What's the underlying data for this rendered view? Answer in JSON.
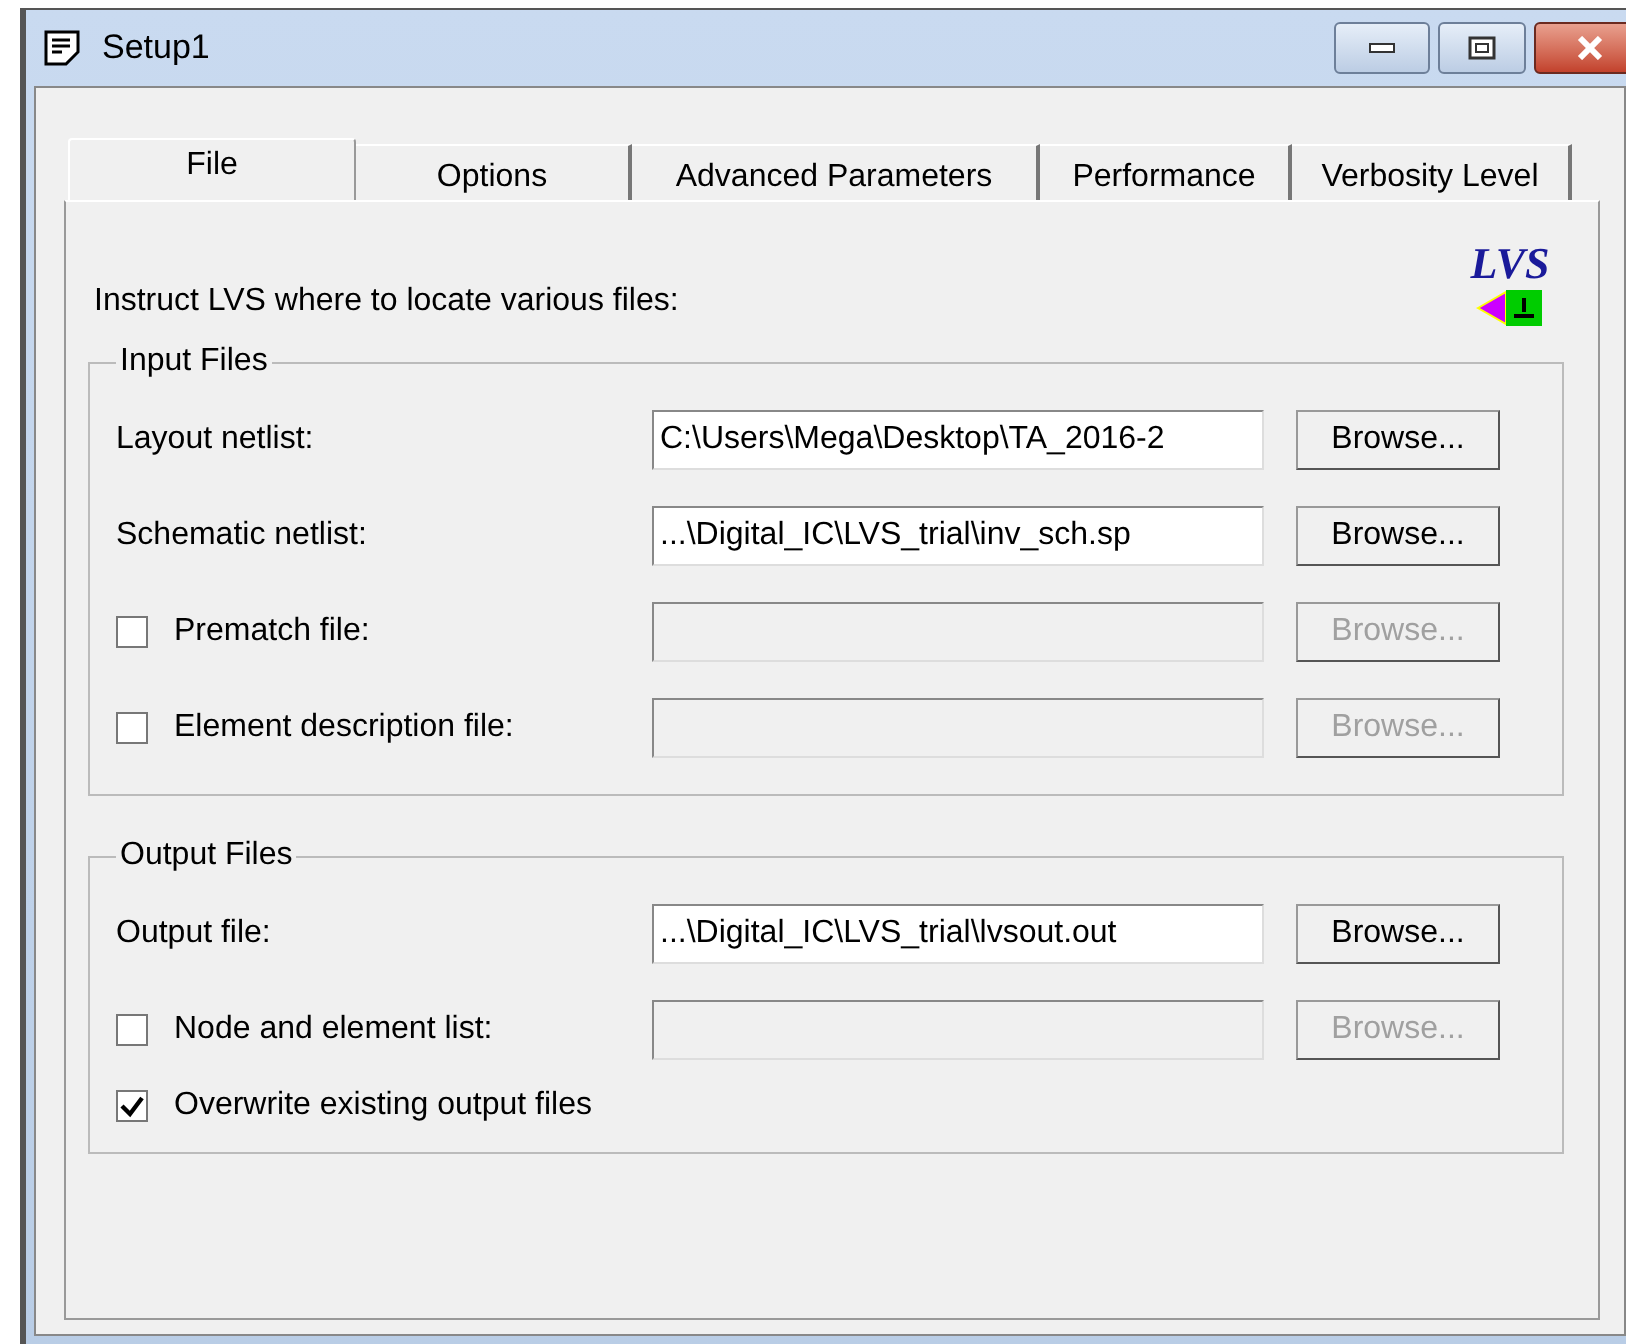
{
  "window": {
    "title": "Setup1"
  },
  "tabs": [
    {
      "label": "File",
      "selected": true
    },
    {
      "label": "Options",
      "selected": false
    },
    {
      "label": "Advanced Parameters",
      "selected": false
    },
    {
      "label": "Performance",
      "selected": false
    },
    {
      "label": "Verbosity Level",
      "selected": false
    }
  ],
  "instruction": "Instruct LVS where to locate various files:",
  "logo": {
    "text": "LVS"
  },
  "groups": [
    {
      "title": "Input Files",
      "rows": [
        {
          "kind": "file",
          "label": "Layout netlist:",
          "value": "C:\\Users\\Mega\\Desktop\\TA_2016-2",
          "button": "Browse...",
          "disabled": false
        },
        {
          "kind": "file",
          "label": "Schematic netlist:",
          "value": "...\\Digital_IC\\LVS_trial\\inv_sch.sp",
          "button": "Browse...",
          "disabled": false
        },
        {
          "kind": "checkfile",
          "label": "Prematch file:",
          "checked": false,
          "button": "Browse...",
          "disabled": true
        },
        {
          "kind": "checkfile",
          "label": "Element description file:",
          "checked": false,
          "button": "Browse...",
          "disabled": true
        }
      ]
    },
    {
      "title": "Output Files",
      "rows": [
        {
          "kind": "file",
          "label": "Output file:",
          "value": "...\\Digital_IC\\LVS_trial\\lvsout.out",
          "button": "Browse...",
          "disabled": false
        },
        {
          "kind": "checkfile",
          "label": "Node and element list:",
          "checked": false,
          "button": "Browse...",
          "disabled": true
        },
        {
          "kind": "check",
          "label": "Overwrite existing output files",
          "checked": true
        }
      ]
    }
  ]
}
